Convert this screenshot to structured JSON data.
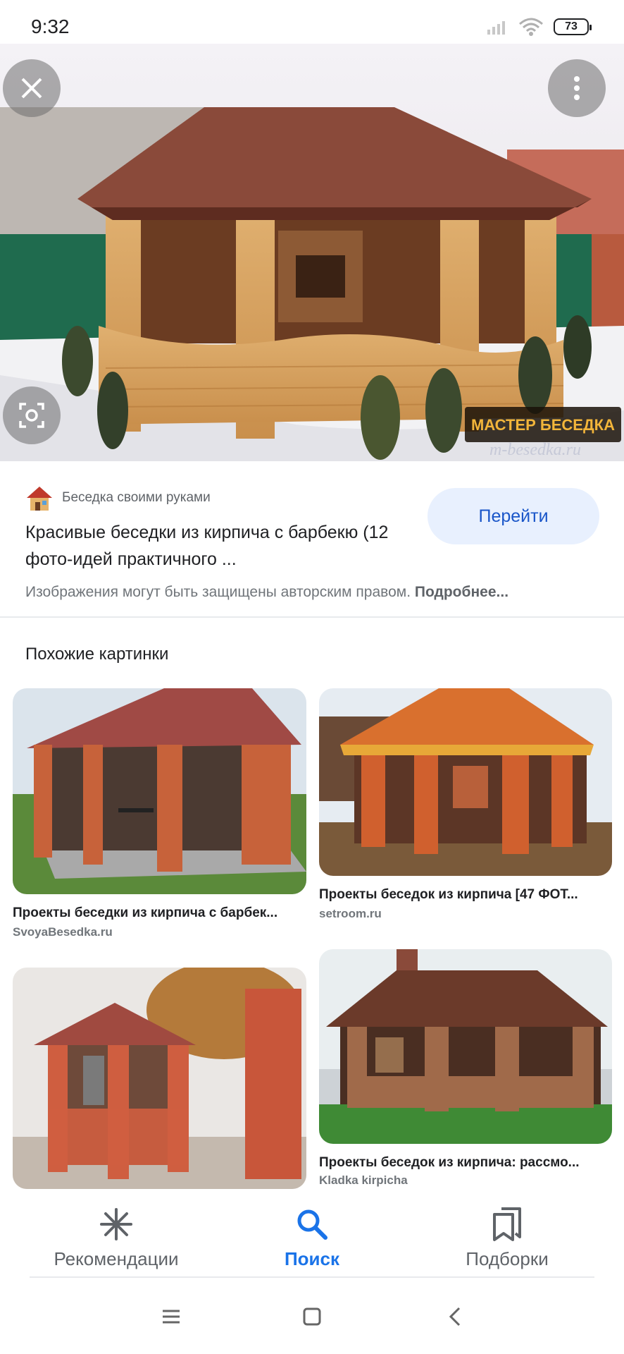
{
  "status_bar": {
    "time": "9:32",
    "battery": "73"
  },
  "source": {
    "site_name": "Беседка своими руками"
  },
  "result": {
    "title": "Красивые беседки из кирпича с барбекю (12 фото-идей практичного ...",
    "go_button": "Перейти"
  },
  "copyright": {
    "text": "Изображения могут быть защищены авторским правом.",
    "more": "Подробнее..."
  },
  "watermark": {
    "brand": "МАСТЕР БЕСЕДКА",
    "url": "m-besedka.ru"
  },
  "similar": {
    "heading": "Похожие картинки",
    "items": [
      {
        "title": "Проекты беседки из кирпича с барбек...",
        "source": "SvoyaBesedka.ru"
      },
      {
        "title": "Проекты беседок из кирпича [47 ФОТ...",
        "source": "setroom.ru"
      },
      {
        "title": "",
        "source": ""
      },
      {
        "title": "Проекты беседок из кирпича: рассмо...",
        "source": "Kladka kirpicha"
      }
    ]
  },
  "bottom_nav": {
    "items": [
      {
        "label": "Рекомендации",
        "icon": "asterisk-icon"
      },
      {
        "label": "Поиск",
        "icon": "search-icon",
        "active": true
      },
      {
        "label": "Подборки",
        "icon": "collections-icon"
      }
    ]
  },
  "colors": {
    "accent": "#1a73e8",
    "button_bg": "#e8f0fe",
    "muted": "#70757a"
  }
}
